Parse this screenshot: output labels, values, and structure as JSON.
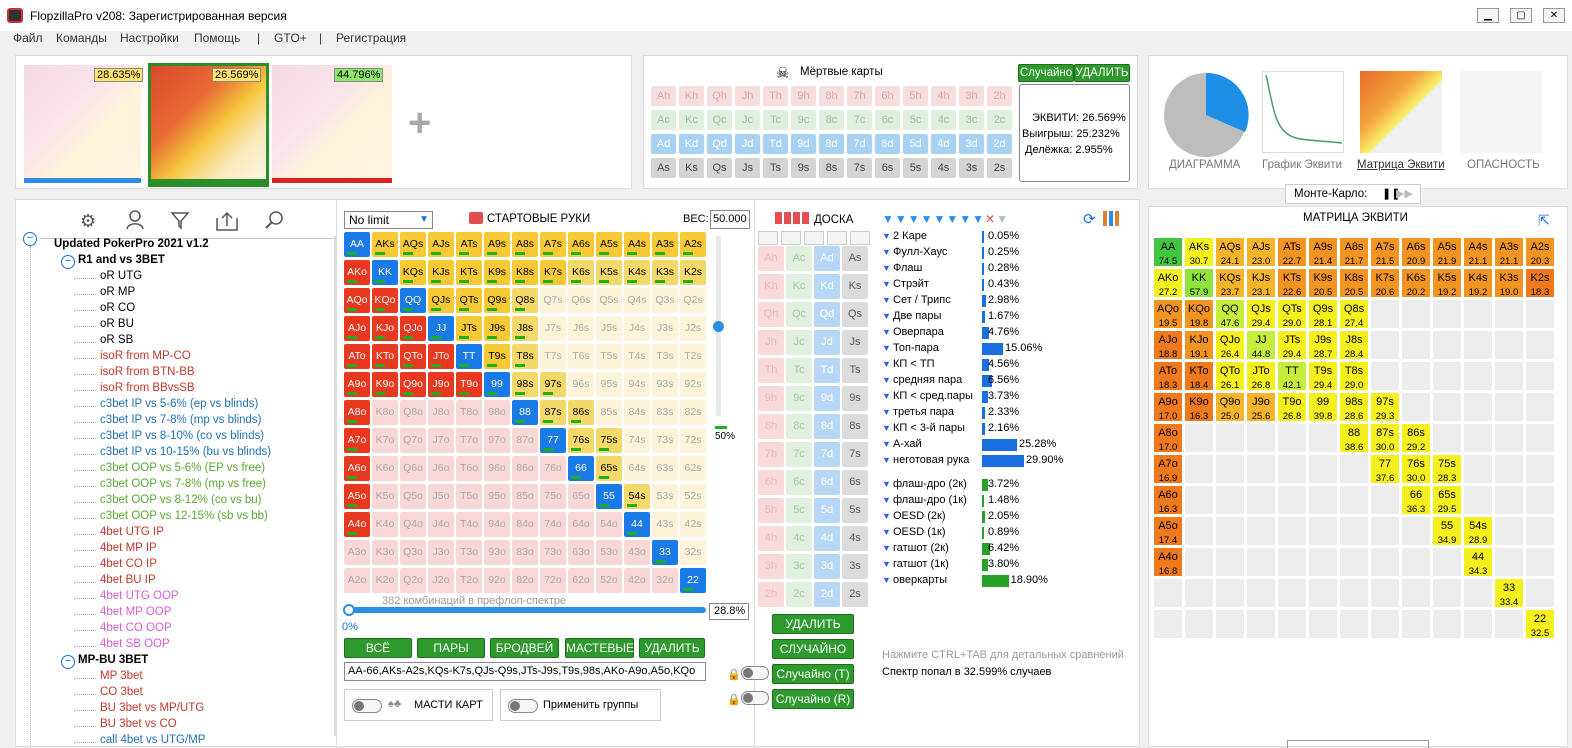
{
  "app": {
    "title": "FlopzillaPro v208: Зарегистрированная версия"
  },
  "menu": [
    "Файл",
    "Команды",
    "Настройки",
    "Помощь",
    "|",
    "GTO+",
    "|",
    "Регистрация"
  ],
  "ranges": [
    {
      "pct": "28.635%"
    },
    {
      "pct": "26.569%"
    },
    {
      "pct": "44.796%"
    }
  ],
  "dead": {
    "title": "Мёртвые карты",
    "random": "Случайно",
    "delete": "УДАЛИТЬ",
    "rows": [
      [
        "Ah",
        "Kh",
        "Qh",
        "Jh",
        "Th",
        "9h",
        "8h",
        "7h",
        "6h",
        "5h",
        "4h",
        "3h",
        "2h"
      ],
      [
        "Ac",
        "Kc",
        "Qc",
        "Jc",
        "Tc",
        "9c",
        "8c",
        "7c",
        "6c",
        "5c",
        "4c",
        "3c",
        "2c"
      ],
      [
        "Ad",
        "Kd",
        "Qd",
        "Jd",
        "Td",
        "9d",
        "8d",
        "7d",
        "6d",
        "5d",
        "4d",
        "3d",
        "2d"
      ],
      [
        "As",
        "Ks",
        "Qs",
        "Js",
        "Ts",
        "9s",
        "8s",
        "7s",
        "6s",
        "5s",
        "4s",
        "3s",
        "2s"
      ]
    ]
  },
  "equity": {
    "eq": "ЭКВИТИ: 26.569%",
    "win": "Выигрыш: 25.232%",
    "tie": "Делёжка: 2.955%"
  },
  "views": {
    "diagram": "ДИАГРАММА",
    "graph": "График Эквити",
    "matrix": "Матрица Эквити",
    "danger": "ОПАСНОСТЬ",
    "mc": "Монте-Карло:"
  },
  "tree": {
    "root": "Updated PokerPro 2021 v1.2",
    "items": [
      {
        "t": "R1 and vs 3BET",
        "c": "#000",
        "lvl": 1,
        "b": true
      },
      {
        "t": "oR UTG",
        "c": "#000",
        "lvl": 2
      },
      {
        "t": "oR MP",
        "c": "#000",
        "lvl": 2
      },
      {
        "t": "oR CO",
        "c": "#000",
        "lvl": 2
      },
      {
        "t": "oR BU",
        "c": "#000",
        "lvl": 2
      },
      {
        "t": "oR SB",
        "c": "#000",
        "lvl": 2
      },
      {
        "t": "isoR from MP-CO",
        "c": "#c0392b",
        "lvl": 2
      },
      {
        "t": "isoR from BTN-BB",
        "c": "#c0392b",
        "lvl": 2
      },
      {
        "t": "isoR from BBvsSB",
        "c": "#c0392b",
        "lvl": 2
      },
      {
        "t": "c3bet IP vs 5-6% (ep vs blinds)",
        "c": "#1f6fb5",
        "lvl": 2
      },
      {
        "t": "c3bet IP vs 7-8% (mp vs blinds)",
        "c": "#1f6fb5",
        "lvl": 2
      },
      {
        "t": "c3bet IP vs 8-10% (co vs blinds)",
        "c": "#1f6fb5",
        "lvl": 2
      },
      {
        "t": "c3bet IP vs 10-15% (bu vs blinds)",
        "c": "#1f6fb5",
        "lvl": 2
      },
      {
        "t": "c3bet OOP vs 5-6% (EP vs free)",
        "c": "#5aa832",
        "lvl": 2
      },
      {
        "t": "c3bet OOP vs 7-8% (mp vs free)",
        "c": "#5aa832",
        "lvl": 2
      },
      {
        "t": "c3bet OOP vs 8-12% (co vs bu)",
        "c": "#5aa832",
        "lvl": 2
      },
      {
        "t": "c3bet OOP vs 12-15% (sb vs bb)",
        "c": "#5aa832",
        "lvl": 2
      },
      {
        "t": "4bet UTG IP",
        "c": "#c0392b",
        "lvl": 2
      },
      {
        "t": "4bet MP IP",
        "c": "#c0392b",
        "lvl": 2
      },
      {
        "t": "4bet CO IP",
        "c": "#c0392b",
        "lvl": 2
      },
      {
        "t": "4bet BU IP",
        "c": "#c0392b",
        "lvl": 2
      },
      {
        "t": "4bet UTG OOP",
        "c": "#d35fd3",
        "lvl": 2
      },
      {
        "t": "4bet MP OOP",
        "c": "#d35fd3",
        "lvl": 2
      },
      {
        "t": "4bet CO OOP",
        "c": "#d35fd3",
        "lvl": 2
      },
      {
        "t": "4bet SB OOP",
        "c": "#d35fd3",
        "lvl": 2
      },
      {
        "t": "MP-BU 3BET",
        "c": "#000",
        "lvl": 1,
        "b": true
      },
      {
        "t": "MP 3bet",
        "c": "#c0392b",
        "lvl": 2
      },
      {
        "t": "CO 3bet",
        "c": "#c0392b",
        "lvl": 2
      },
      {
        "t": "BU 3bet vs MP/UTG",
        "c": "#c0392b",
        "lvl": 2
      },
      {
        "t": "BU 3bet vs CO",
        "c": "#c0392b",
        "lvl": 2
      },
      {
        "t": "call 4bet vs UTG/MP",
        "c": "#1f6fb5",
        "lvl": 2
      }
    ]
  },
  "hands": {
    "select": "No limit",
    "title": "СТАРТОВЫЕ РУКИ",
    "weight_label": "ВЕС:",
    "weight": "50.000",
    "slider_pct": "50%",
    "combos": "382 комбинаций в префлоп-спектре",
    "range_pct": "28.8%",
    "zero": "0%",
    "btn_all": "ВСЁ",
    "btn_pairs": "ПАРЫ",
    "btn_broad": "БРОДВЕЙ",
    "btn_suited": "МАСТЕВЫЕ",
    "btn_del": "УДАЛИТЬ",
    "range_text": "AA-66,AKs-A2s,KQs-K7s,QJs-Q9s,JTs-J9s,T9s,98s,AKo-A9o,A5o,KQo",
    "suits": "МАСТИ КАРТ",
    "groups": "Применить группы"
  },
  "board": {
    "title": "ДОСКА",
    "delete": "УДАЛИТЬ",
    "random": "СЛУЧАЙНО",
    "randT": "Случайно (T)",
    "randR": "Случайно (R)"
  },
  "stats": [
    {
      "n": "2 Каре",
      "v": "0.05%",
      "w": 0
    },
    {
      "n": "Фулл-Хаус",
      "v": "0.25%",
      "w": 0
    },
    {
      "n": "Флаш",
      "v": "0.28%",
      "w": 0
    },
    {
      "n": "Стрэйт",
      "v": "0.43%",
      "w": 0
    },
    {
      "n": "Сет / Трипс",
      "v": "2.98%",
      "w": 3
    },
    {
      "n": "Две пары",
      "v": "1.67%",
      "w": 2
    },
    {
      "n": "Оверпара",
      "v": "4.76%",
      "w": 5
    },
    {
      "n": "Топ-пара",
      "v": "15.06%",
      "w": 15
    },
    {
      "n": "КП < ТП",
      "v": "4.56%",
      "w": 5
    },
    {
      "n": "средняя пара",
      "v": "6.56%",
      "w": 7
    },
    {
      "n": "КП < сред.пары",
      "v": "3.73%",
      "w": 4
    },
    {
      "n": "третья пара",
      "v": "2.33%",
      "w": 2
    },
    {
      "n": "КП < 3-й пары",
      "v": "2.16%",
      "w": 2
    },
    {
      "n": "А-хай",
      "v": "25.28%",
      "w": 25
    },
    {
      "n": "неготовая рука",
      "v": "29.90%",
      "w": 30
    }
  ],
  "draws": [
    {
      "n": "флаш-дро (2к)",
      "v": "3.72%",
      "w": 4
    },
    {
      "n": "флаш-дро (1к)",
      "v": "1.48%",
      "w": 1
    },
    {
      "n": "OESD (2к)",
      "v": "2.05%",
      "w": 2
    },
    {
      "n": "OESD (1к)",
      "v": "0.89%",
      "w": 1
    },
    {
      "n": "гатшот (2к)",
      "v": "6.42%",
      "w": 6
    },
    {
      "n": "гатшот (1к)",
      "v": "3.80%",
      "w": 4
    },
    {
      "n": "оверкарты",
      "v": "18.90%",
      "w": 19
    }
  ],
  "hint": "Нажмите CTRL+TAB для детальных сравнений",
  "hit": "Спектр попал в 32.599% случаев",
  "eqmatrix": {
    "title": "МАТРИЦА ЭКВИТИ",
    "cells": {
      "AA": "74.5",
      "AKs": "30.7",
      "AQs": "24.1",
      "AJs": "23.0",
      "ATs": "22.7",
      "A9s": "21.4",
      "A8s": "21.7",
      "A7s": "21.5",
      "A6s": "20.9",
      "A5s": "21.9",
      "A4s": "21.1",
      "A3s": "21.1",
      "A2s": "20.3",
      "AKo": "27.2",
      "KK": "57.9",
      "KQs": "23.7",
      "KJs": "23.1",
      "KTs": "22.6",
      "K9s": "20.5",
      "K8s": "20.5",
      "K7s": "20.6",
      "K6s": "20.2",
      "K5s": "19.2",
      "K4s": "19.2",
      "K3s": "19.0",
      "K2s": "18.3",
      "AQo": "19.5",
      "KQo": "19.8",
      "QQ": "47.6",
      "QJs": "29.4",
      "QTs": "29.0",
      "Q9s": "28.1",
      "Q8s": "27.4",
      "AJo": "18.8",
      "KJo": "19.1",
      "QJo": "26.4",
      "JJ": "44.8",
      "JTs": "29.4",
      "J9s": "28.7",
      "J8s": "28.4",
      "ATo": "18.3",
      "KTo": "18.4",
      "QTo": "26.1",
      "JTo": "26.8",
      "TT": "42.1",
      "T9s": "29.4",
      "T8s": "29.0",
      "A9o": "17.0",
      "K9o": "16.3",
      "Q9o": "25.0",
      "J9o": "25.6",
      "T9o": "26.8",
      "99": "39.8",
      "98s": "28.6",
      "97s": "29.3",
      "A8o": "17.0",
      "88": "38.6",
      "87s": "30.0",
      "86s": "29.2",
      "A7o": "16.9",
      "77": "37.6",
      "76s": "30.0",
      "75s": "28.3",
      "A6o": "16.3",
      "66": "36.3",
      "65s": "29.5",
      "A5o": "17.4",
      "55": "34.9",
      "54s": "28.9",
      "A4o": "16.8",
      "44": "34.3",
      "33": "33.4",
      "22": "32.5"
    }
  }
}
